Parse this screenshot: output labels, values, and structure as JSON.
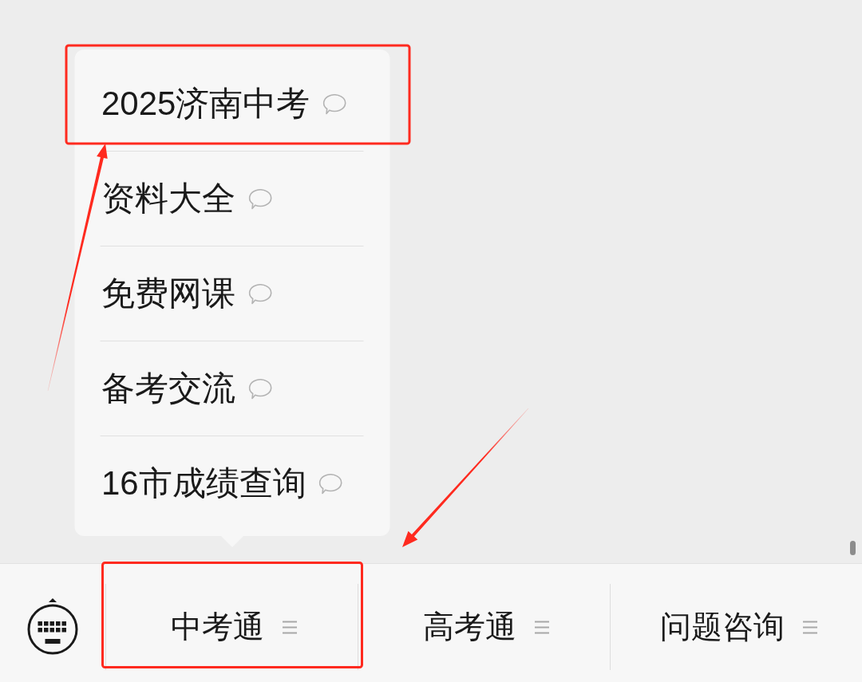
{
  "bottom_bar": {
    "tabs": [
      {
        "label": "中考通",
        "menu": [
          {
            "label": "2025济南中考"
          },
          {
            "label": "资料大全"
          },
          {
            "label": "免费网课"
          },
          {
            "label": "备考交流"
          },
          {
            "label": "16市成绩查询"
          }
        ]
      },
      {
        "label": "高考通"
      },
      {
        "label": "问题咨询"
      }
    ]
  }
}
